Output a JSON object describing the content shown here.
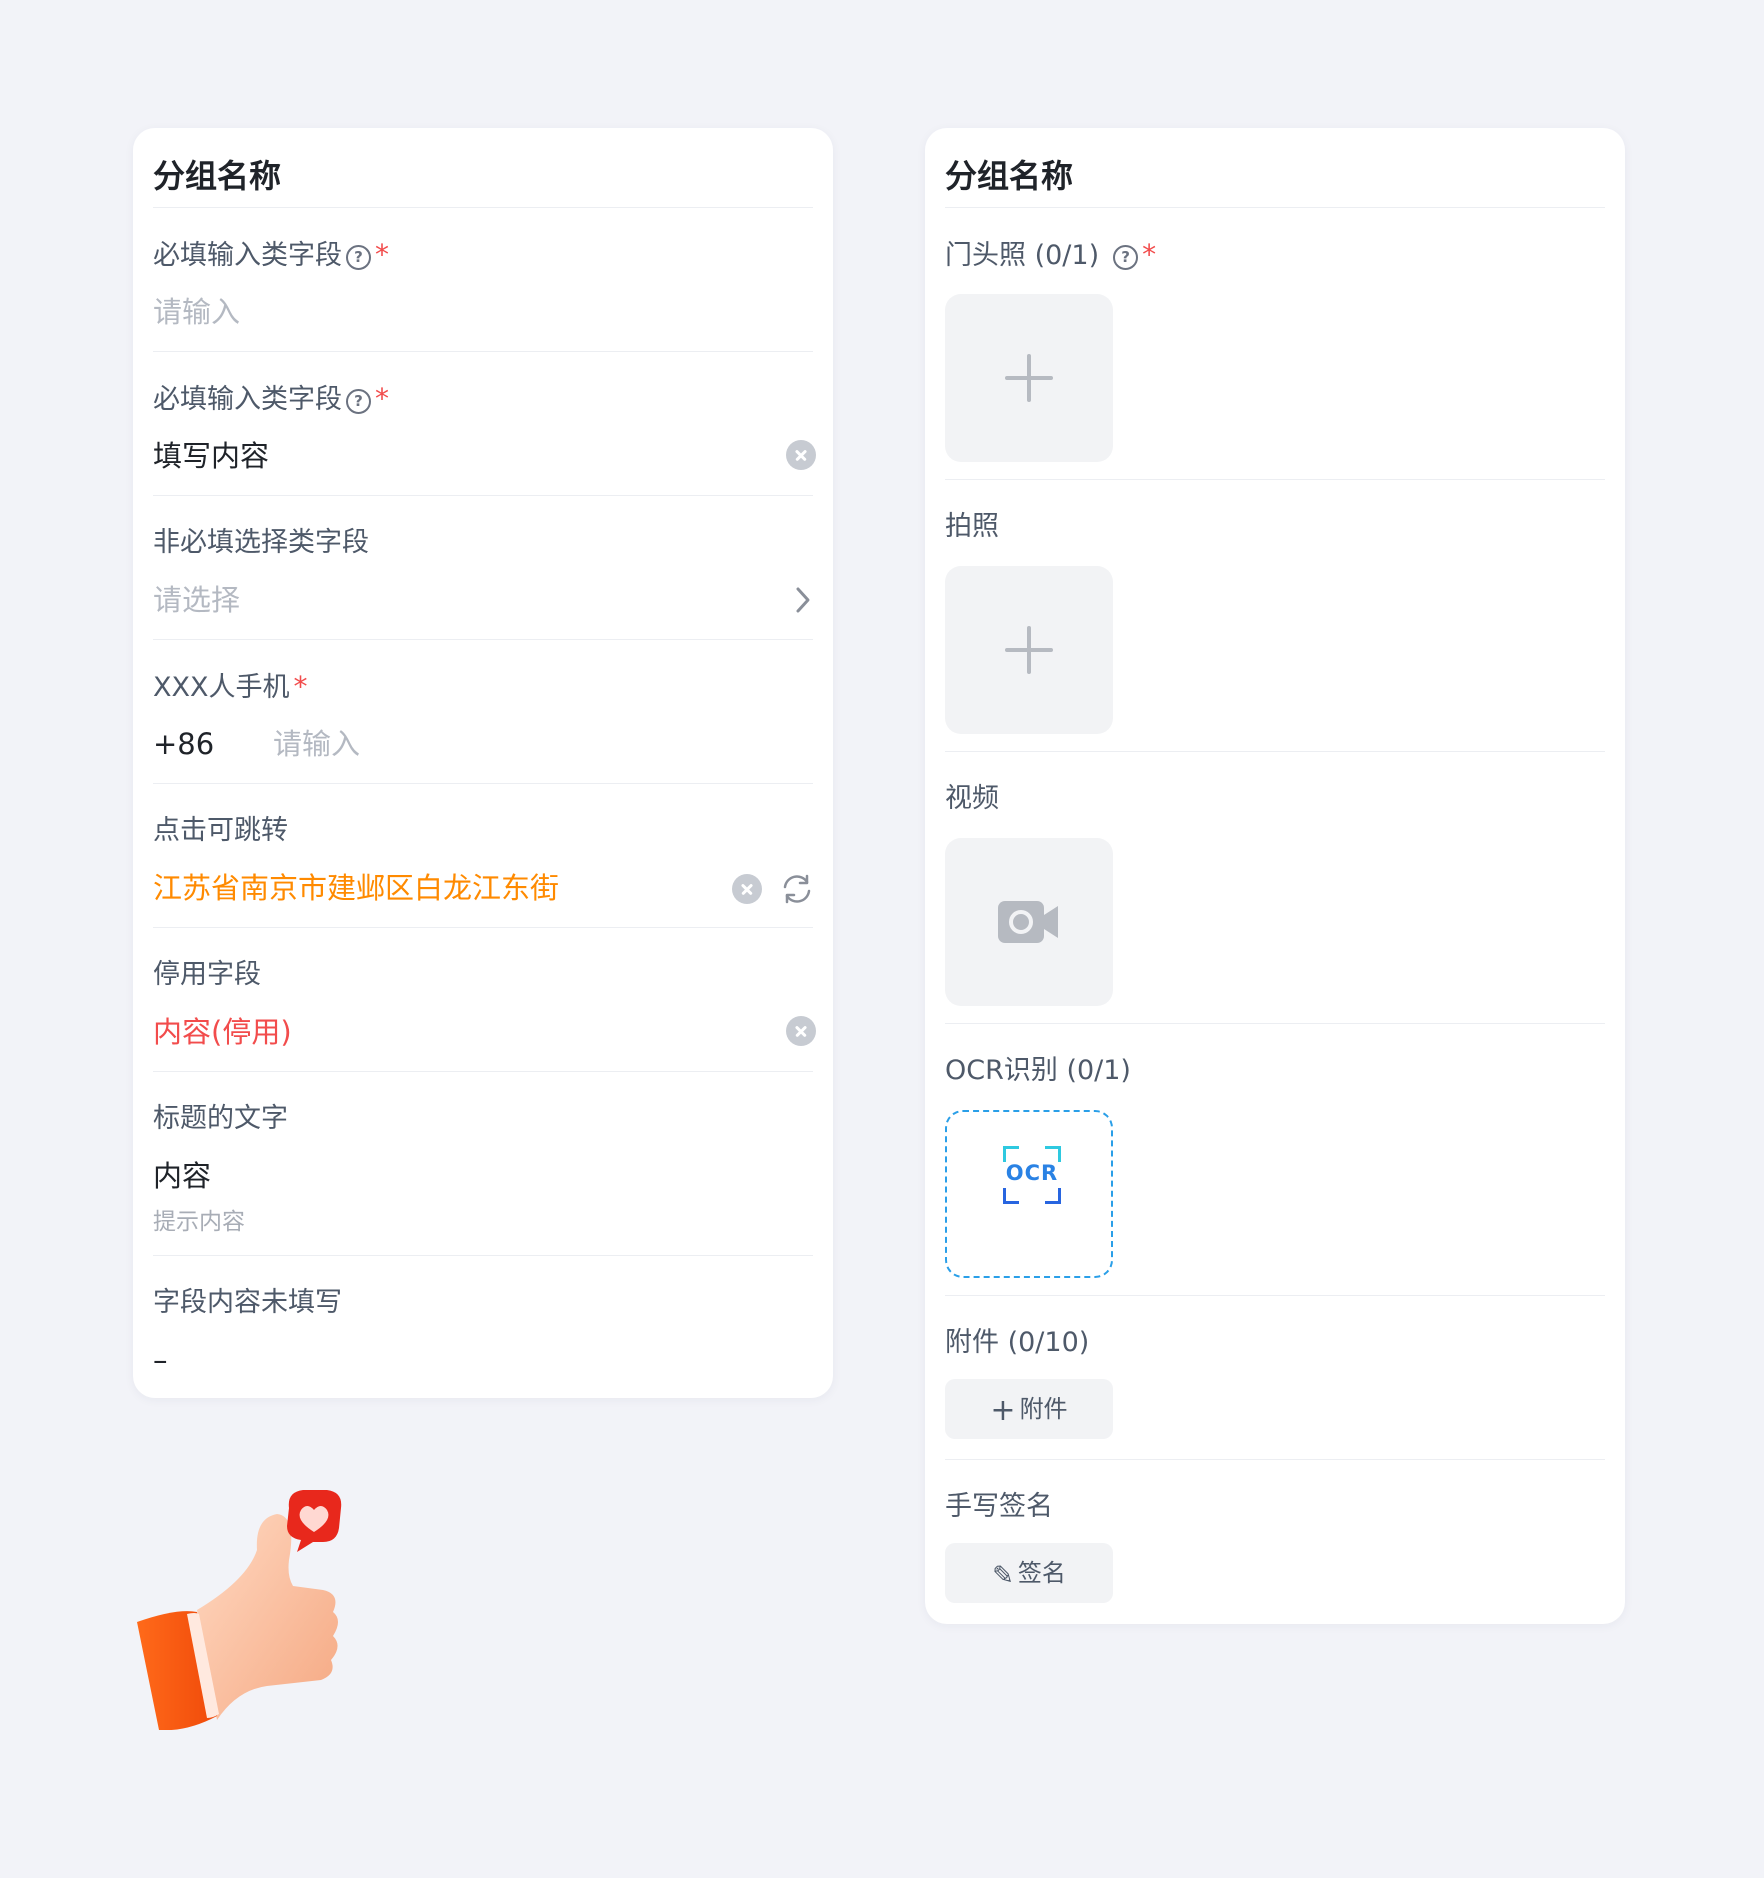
{
  "left_card": {
    "title": "分组名称",
    "fields": [
      {
        "label": "必填输入类字段",
        "help": "?",
        "required": "*",
        "placeholder": "请输入"
      },
      {
        "label": "必填输入类字段",
        "help": "?",
        "required": "*",
        "value": "填写内容"
      },
      {
        "label": "非必填选择类字段",
        "placeholder": "请选择"
      },
      {
        "label": "XXX人手机",
        "required": "*",
        "prefix": "+86",
        "placeholder": "请输入"
      },
      {
        "label": "点击可跳转",
        "value": "江苏省南京市建邺区白龙江东街"
      },
      {
        "label": "停用字段",
        "value": "内容(停用)"
      },
      {
        "label": "标题的文字",
        "value": "内容",
        "hint": "提示内容"
      },
      {
        "label": "字段内容未填写",
        "value": "–"
      }
    ]
  },
  "right_card": {
    "title": "分组名称",
    "fields": [
      {
        "label": "门头照 (0/1)",
        "help": "?",
        "required": "*"
      },
      {
        "label": "拍照"
      },
      {
        "label": "视频"
      },
      {
        "label": "OCR识别 (0/1)",
        "ocr_text": "OCR"
      },
      {
        "label": "附件 (0/10)",
        "button_icon": "+",
        "button_label": "附件"
      },
      {
        "label": "手写签名",
        "button_icon": "✎",
        "button_label": "签名"
      }
    ]
  },
  "colors": {
    "link": "#ff8a00",
    "disabled": "#f24c4c",
    "required": "#f24c4c",
    "placeholder": "#b4b9c2",
    "ocr_blue": "#2a82e4"
  }
}
